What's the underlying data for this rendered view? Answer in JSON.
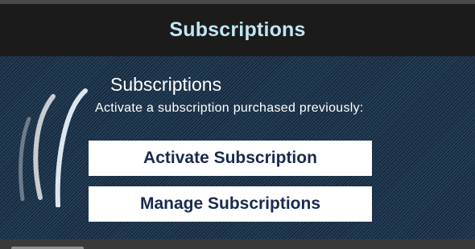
{
  "header": {
    "title": "Subscriptions"
  },
  "panel": {
    "heading": "Subscriptions",
    "description": "Activate a subscription purchased previously:",
    "logo_icon": "wave-logo-icon"
  },
  "buttons": {
    "activate_label": "Activate Subscription",
    "manage_label": "Manage Subscriptions"
  },
  "colors": {
    "title_text": "#bfe6f4",
    "header_bg": "#1b1b1b",
    "panel_bg": "#1f3a55",
    "button_bg": "#ffffff",
    "button_text": "#1a2a4e"
  }
}
